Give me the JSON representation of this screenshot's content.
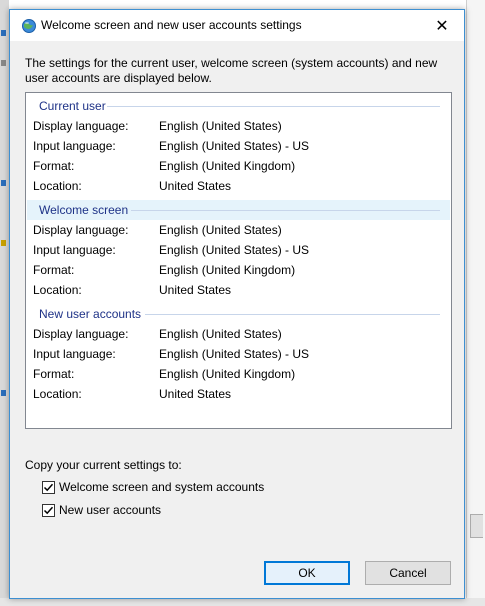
{
  "dialog": {
    "title": "Welcome screen and new user accounts settings",
    "description": "The settings for the current user, welcome screen (system accounts) and new user accounts are displayed below."
  },
  "groups": [
    {
      "name": "Current user",
      "rows": [
        {
          "label": "Display language:",
          "value": "English (United States)"
        },
        {
          "label": "Input language:",
          "value": "English (United States) - US"
        },
        {
          "label": "Format:",
          "value": "English (United Kingdom)"
        },
        {
          "label": "Location:",
          "value": "United States"
        }
      ]
    },
    {
      "name": "Welcome screen",
      "rows": [
        {
          "label": "Display language:",
          "value": "English (United States)"
        },
        {
          "label": "Input language:",
          "value": "English (United States) - US"
        },
        {
          "label": "Format:",
          "value": "English (United Kingdom)"
        },
        {
          "label": "Location:",
          "value": "United States"
        }
      ]
    },
    {
      "name": "New user accounts",
      "rows": [
        {
          "label": "Display language:",
          "value": "English (United States)"
        },
        {
          "label": "Input language:",
          "value": "English (United States) - US"
        },
        {
          "label": "Format:",
          "value": "English (United Kingdom)"
        },
        {
          "label": "Location:",
          "value": "United States"
        }
      ]
    }
  ],
  "copy": {
    "label": "Copy your current settings to:",
    "options": [
      {
        "label": "Welcome screen and system accounts",
        "checked": true
      },
      {
        "label": "New user accounts",
        "checked": true
      }
    ]
  },
  "buttons": {
    "ok": "OK",
    "cancel": "Cancel"
  },
  "colors": {
    "group_header_text": "#1e3287",
    "selected_group_bg": "#e5f3fb",
    "focus_border": "#0078d7"
  }
}
